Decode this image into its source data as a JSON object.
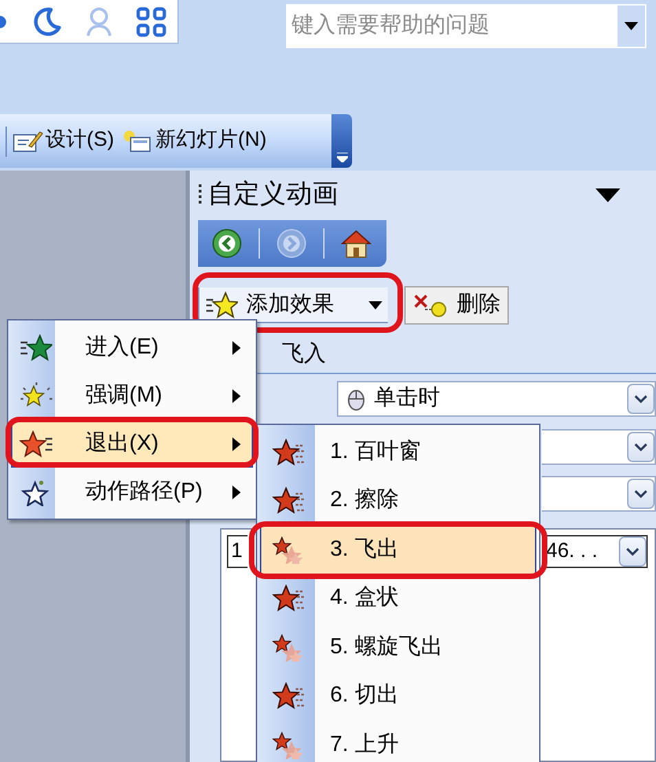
{
  "help_box": {
    "placeholder": "键入需要帮助的问题"
  },
  "toolbar": {
    "buttons": [
      {
        "label": "设计(S)",
        "kind": "design"
      },
      {
        "label": "新幻灯片(N)",
        "kind": "new_slide"
      }
    ]
  },
  "task_pane": {
    "title": "自定义动画",
    "add_effect_button": {
      "label": "添加效果",
      "annotated": true
    },
    "remove_button": "删除",
    "effect_name": "飞入",
    "start_value": "单击时",
    "list_item": {
      "index": "1",
      "text": "46. . ."
    }
  },
  "menu": {
    "items": [
      {
        "label": "进入(E)",
        "kind": "entrance",
        "selected": false,
        "annotated": false
      },
      {
        "label": "强调(M)",
        "kind": "emphasis",
        "selected": false,
        "annotated": false
      },
      {
        "label": "退出(X)",
        "kind": "exit",
        "selected": true,
        "annotated": true
      },
      {
        "label": "动作路径(P)",
        "kind": "path",
        "selected": false,
        "annotated": false
      }
    ]
  },
  "submenu": {
    "items": [
      {
        "label": "1. 百叶窗",
        "kind": "burst",
        "selected": false,
        "annotated": false
      },
      {
        "label": "2. 擦除",
        "kind": "burst",
        "selected": false,
        "annotated": false
      },
      {
        "label": "3. 飞出",
        "kind": "trail",
        "selected": true,
        "annotated": true
      },
      {
        "label": "4. 盒状",
        "kind": "burst",
        "selected": false,
        "annotated": false
      },
      {
        "label": "5. 螺旋飞出",
        "kind": "trail",
        "selected": false,
        "annotated": false
      },
      {
        "label": "6. 切出",
        "kind": "burst",
        "selected": false,
        "annotated": false
      },
      {
        "label": "7. 上升",
        "kind": "trail",
        "selected": false,
        "annotated": false
      }
    ]
  }
}
